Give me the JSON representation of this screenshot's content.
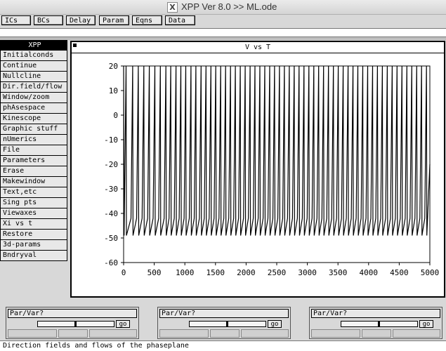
{
  "window": {
    "title": "XPP Ver 8.0 >> ML.ode"
  },
  "top_buttons": [
    "ICs",
    "BCs",
    "Delay",
    "Param",
    "Eqns",
    "Data"
  ],
  "menu": {
    "header": "XPP",
    "items": [
      "Initialconds",
      "Continue",
      "Nullcline",
      "Dir.field/flow",
      "Window/zoom",
      "phAsespace",
      "Kinescope",
      "Graphic stuff",
      "nUmerics",
      "File",
      "Parameters",
      "Erase",
      "Makewindow",
      "Text,etc",
      "Sing pts",
      "Viewaxes",
      "Xi vs t",
      "Restore",
      "3d-params",
      "Bndryval"
    ]
  },
  "plot": {
    "title": "V vs T"
  },
  "sliders": [
    {
      "label": "Par/Var?",
      "go": "go",
      "position": 0.5
    },
    {
      "label": "Par/Var?",
      "go": "go",
      "position": 0.5
    },
    {
      "label": "Par/Var?",
      "go": "go",
      "position": 0.5
    }
  ],
  "status": "Direction fields and flows of the phaseplane",
  "chart_data": {
    "type": "line",
    "title": "V vs T",
    "xlabel": "",
    "ylabel": "",
    "xlim": [
      0,
      5000
    ],
    "ylim": [
      -60,
      20
    ],
    "xticks": [
      0,
      500,
      1000,
      1500,
      2000,
      2500,
      3000,
      3500,
      4000,
      4500,
      5000
    ],
    "yticks": [
      20,
      10,
      0,
      -10,
      -20,
      -30,
      -40,
      -50,
      -60
    ],
    "series": [
      {
        "name": "",
        "description_of_shape": "periodic spiking oscillation",
        "spike_times": [
          40,
          148,
          240,
          330,
          420,
          510,
          600,
          690,
          770,
          855,
          935,
          1015,
          1100,
          1180,
          1265,
          1345,
          1425,
          1505,
          1585,
          1665,
          1745,
          1825,
          1905,
          1985,
          2065,
          2145,
          2225,
          2305,
          2385,
          2465,
          2545,
          2625,
          2705,
          2785,
          2865,
          2945,
          3025,
          3105,
          3185,
          3265,
          3345,
          3425,
          3505,
          3585,
          3665,
          3745,
          3825,
          3905,
          3985,
          4065,
          4145,
          4225,
          4305,
          4385,
          4465,
          4545,
          4625,
          4705,
          4785,
          4865,
          4945
        ],
        "peak": 20,
        "trough": -49,
        "start_value": 20
      }
    ],
    "grid": false
  }
}
